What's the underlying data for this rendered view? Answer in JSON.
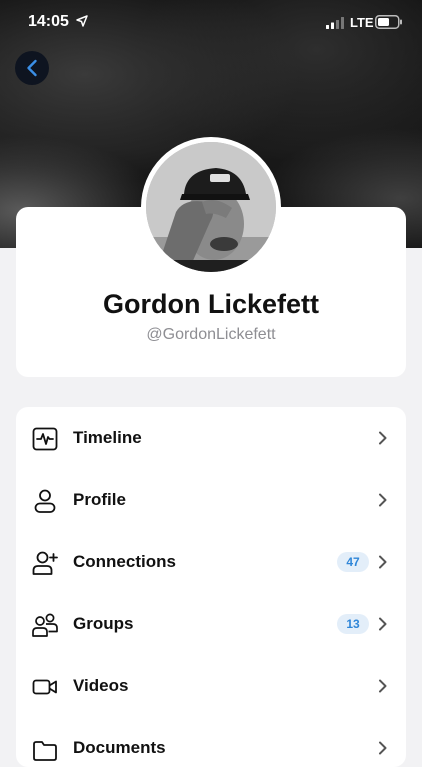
{
  "status_bar": {
    "time": "14:05",
    "network": "LTE",
    "icons": [
      "location-arrow-icon",
      "signal-icon",
      "battery-icon"
    ]
  },
  "nav": {
    "back_icon": "chevron-left-icon"
  },
  "profile": {
    "name": "Gordon Lickefett",
    "handle": "@GordonLickefett"
  },
  "menu": [
    {
      "label": "Timeline",
      "icon": "activity-icon",
      "badge": ""
    },
    {
      "label": "Profile",
      "icon": "person-icon",
      "badge": ""
    },
    {
      "label": "Connections",
      "icon": "person-add-icon",
      "badge": "47"
    },
    {
      "label": "Groups",
      "icon": "people-icon",
      "badge": "13"
    },
    {
      "label": "Videos",
      "icon": "video-camera-icon",
      "badge": ""
    },
    {
      "label": "Documents",
      "icon": "folder-icon",
      "badge": ""
    }
  ],
  "colors": {
    "accent": "#2f86d8",
    "badge_bg": "#e3eef9",
    "background": "#f2f2f4"
  }
}
